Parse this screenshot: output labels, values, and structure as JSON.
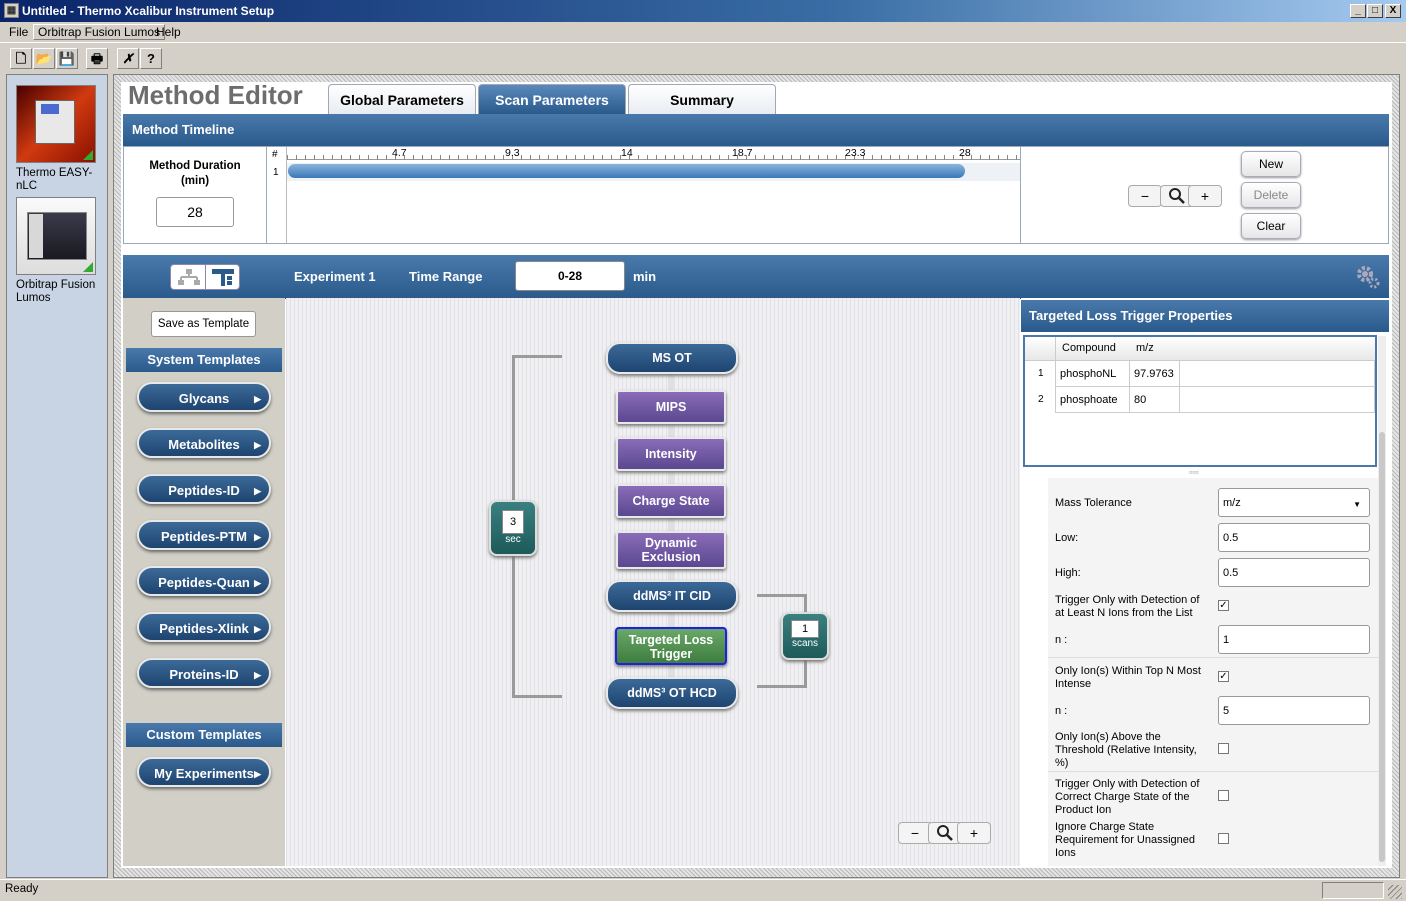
{
  "window": {
    "title": "Untitled - Thermo Xcalibur Instrument Setup",
    "min": "_",
    "max": "□",
    "close": "X"
  },
  "menu": [
    "File",
    "Orbitrap Fusion Lumos",
    "Help"
  ],
  "toolbar": {
    "icons": [
      "new-file-icon",
      "open-folder-icon",
      "save-icon",
      "print-icon",
      "cut-x-icon",
      "help-icon"
    ],
    "glyphs": [
      "🗋",
      "📂",
      "💾",
      "🖶",
      "✗",
      "?"
    ]
  },
  "devices": [
    {
      "label": "Thermo EASY-nLC"
    },
    {
      "label": "Orbitrap Fusion Lumos"
    }
  ],
  "editor": {
    "title": "Method Editor",
    "tabs": [
      "Global Parameters",
      "Scan Parameters",
      "Summary"
    ],
    "active_tab": "Scan Parameters"
  },
  "timeline": {
    "header": "Method Timeline",
    "duration_label": "Method Duration (min)",
    "duration_value": "28",
    "col_hash": "#",
    "row_num": "1",
    "ticks": [
      "4.7",
      "9.3",
      "14",
      "18.7",
      "23.3",
      "28"
    ],
    "zoom": {
      "minus": "−",
      "plus": "+"
    },
    "buttons": {
      "new": "New",
      "delete": "Delete",
      "clear": "Clear"
    }
  },
  "experiment": {
    "label": "Experiment 1",
    "time_range_label": "Time Range",
    "time_range_value": "0-28",
    "unit": "min"
  },
  "templates": {
    "save_button": "Save as Template",
    "system_header": "System Templates",
    "system": [
      "Glycans",
      "Metabolites",
      "Peptides-ID",
      "Peptides-PTM",
      "Peptides-Quan",
      "Peptides-Xlink",
      "Proteins-ID"
    ],
    "custom_header": "Custom Templates",
    "custom": [
      "My Experiments"
    ]
  },
  "flow": {
    "nodes": [
      "MS OT",
      "MIPS",
      "Intensity",
      "Charge State",
      "Dynamic Exclusion",
      "ddMS² IT CID",
      "Targeted Loss Trigger",
      "ddMS³ OT HCD"
    ],
    "cycle_value": "3",
    "cycle_unit": "sec",
    "scans_value": "1",
    "scans_unit": "scans"
  },
  "properties": {
    "header": "Targeted Loss Trigger Properties",
    "table_headers": [
      "Compound",
      "m/z"
    ],
    "rows": [
      {
        "idx": "1",
        "compound": "phosphoNL",
        "mz": "97.9763"
      },
      {
        "idx": "2",
        "compound": "phosphoate",
        "mz": "80"
      }
    ],
    "splitter": "▫▫▫",
    "mass_tolerance_label": "Mass Tolerance",
    "mass_tolerance_value": "m/z",
    "low_label": "Low:",
    "low_value": "0.5",
    "high_label": "High:",
    "high_value": "0.5",
    "trigger_n_label": "Trigger Only with Detection of at Least N Ions from the List",
    "trigger_n_checked": true,
    "n1_label": "n :",
    "n1_value": "1",
    "topn_label": "Only Ion(s) Within Top N Most Intense",
    "topn_checked": true,
    "n2_label": "n :",
    "n2_value": "5",
    "threshold_label": "Only Ion(s) Above the Threshold (Relative Intensity, %)",
    "threshold_checked": false,
    "charge_label": "Trigger Only with Detection of Correct Charge State of the Product Ion",
    "charge_checked": false,
    "ignore_label": "Ignore Charge State Requirement for Unassigned Ions",
    "ignore_checked": false
  },
  "status": {
    "text": "Ready"
  }
}
